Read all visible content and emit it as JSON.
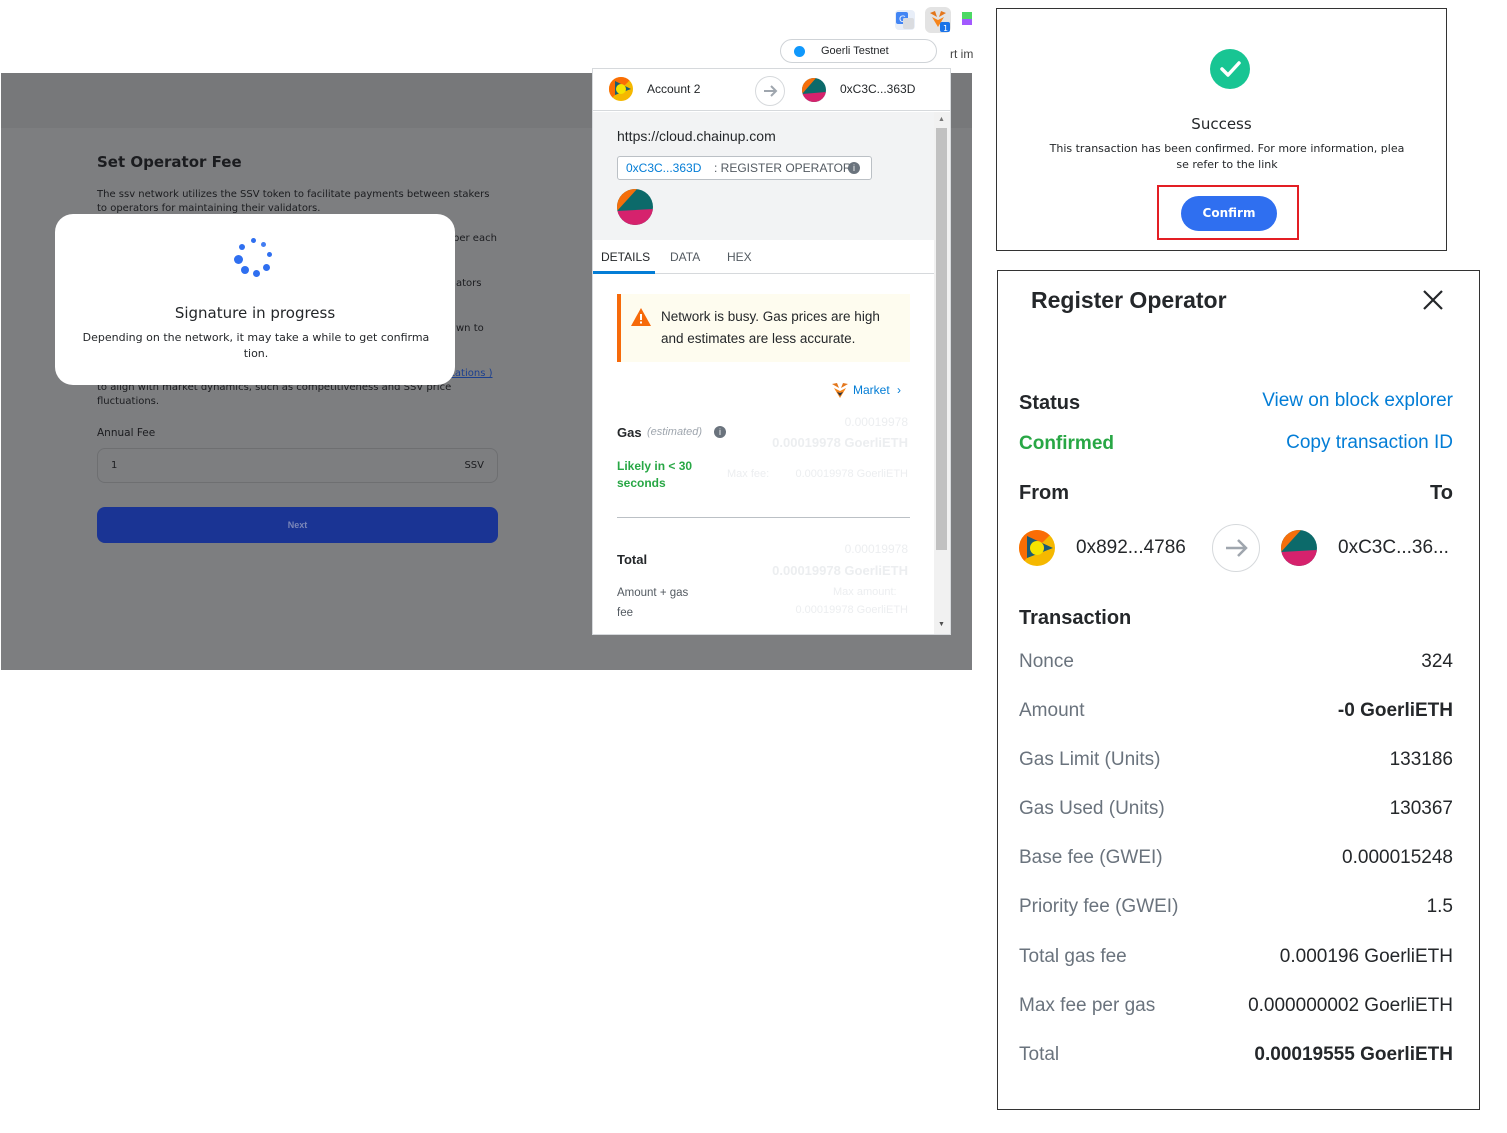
{
  "app": {
    "title": "Set Operator Fee",
    "paragraphs": [
      "The ssv network utilizes the SSV token to facilitate payments between stakers to operators for maintaining their validators.",
      "per each",
      "ators",
      "wn to",
      "tations )",
      "to align with market dynamics, such as competitiveness and SSV price fluctuations."
    ],
    "annual_fee_label": "Annual Fee",
    "annual_fee_value": "1",
    "annual_fee_unit": "SSV",
    "next_label": "Next"
  },
  "signature_modal": {
    "title": "Signature in progress",
    "description": "Depending on the network, it may take a while to get confirmation."
  },
  "browser": {
    "cut_text": "rt im"
  },
  "metamask": {
    "network": "Goerli Testnet",
    "from_account": "Account 2",
    "to_address": "0xC3C...363D",
    "origin": "https://cloud.chainup.com",
    "method_address": "0xC3C...363D",
    "method_name": ": REGISTER OPERATOR",
    "tabs": [
      "DETAILS",
      "DATA",
      "HEX"
    ],
    "warning": "Network is busy. Gas prices are high and estimates are less accurate.",
    "market_label": "Market",
    "gas_label": "Gas",
    "gas_estimated": "(estimated)",
    "gas_value_small": "0.00019978",
    "gas_value_main": "0.00019978 GoerliETH",
    "likely": "Likely in < 30 seconds",
    "max_fee": "Max fee:",
    "max_fee_value": "0.00019978 GoerliETH",
    "total_label": "Total",
    "total_value_small": "0.00019978",
    "total_value_main": "0.00019978 GoerliETH",
    "amount_gas_label": "Amount + gas fee",
    "max_amount": "Max amount:",
    "max_amount_value": "0.00019978 GoerliETH"
  },
  "success": {
    "title": "Success",
    "description": "This transaction has been confirmed. For more information, please refer to the link",
    "confirm_label": "Confirm"
  },
  "register": {
    "title": "Register Operator",
    "status_label": "Status",
    "status_value": "Confirmed",
    "explorer_link": "View on block explorer",
    "copy_link": "Copy transaction ID",
    "from_label": "From",
    "to_label": "To",
    "from_address": "0x892...4786",
    "to_address": "0xC3C...36...",
    "transaction_label": "Transaction",
    "rows": [
      {
        "label": "Nonce",
        "value": "324"
      },
      {
        "label": "Amount",
        "value": "-0 GoerliETH"
      },
      {
        "label": "Gas Limit (Units)",
        "value": "133186"
      },
      {
        "label": "Gas Used (Units)",
        "value": "130367"
      },
      {
        "label": "Base fee (GWEI)",
        "value": "0.000015248"
      },
      {
        "label": "Priority fee (GWEI)",
        "value": "1.5"
      },
      {
        "label": "Total gas fee",
        "value": "0.000196 GoerliETH"
      },
      {
        "label": "Max fee per gas",
        "value": "0.000000002 GoerliETH"
      },
      {
        "label": "Total",
        "value": "0.00019555 GoerliETH"
      }
    ]
  },
  "colors": {
    "accent": "#2f6ff0",
    "success": "#28a745",
    "link": "#037dd6",
    "warning": "#f66a0a",
    "highlight": "#e31e24"
  }
}
